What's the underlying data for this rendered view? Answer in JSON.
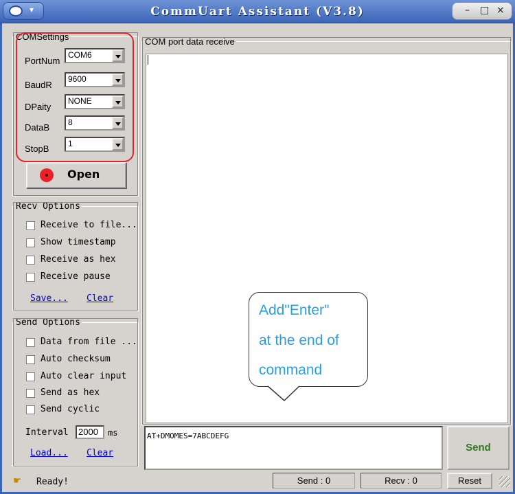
{
  "window": {
    "title": "CommUart Assistant (V3.8)",
    "min": "–",
    "max": "□",
    "close": "×"
  },
  "com_settings": {
    "legend": "COMSettings",
    "fields": [
      {
        "label": "PortNum",
        "value": "COM6"
      },
      {
        "label": "BaudR",
        "value": "9600"
      },
      {
        "label": "DPaity",
        "value": "NONE"
      },
      {
        "label": "DataB",
        "value": "8"
      },
      {
        "label": "StopB",
        "value": "1"
      }
    ],
    "open_label": "Open",
    "led_color": "#e8222a"
  },
  "recv_options": {
    "legend": "Recv Options",
    "checks": [
      "Receive to file...",
      "Show timestamp",
      "Receive as hex",
      "Receive pause"
    ],
    "save": "Save...",
    "clear": "Clear"
  },
  "send_options": {
    "legend": "Send Options",
    "checks": [
      "Data from file ...",
      "Auto checksum",
      "Auto clear input",
      "Send as hex",
      "Send cyclic"
    ],
    "interval_label": "Interval",
    "interval_value": "2000",
    "interval_unit": "ms",
    "load": "Load...",
    "clear": "Clear"
  },
  "receive": {
    "legend": "COM port data receive"
  },
  "callout": {
    "lines": [
      "Add\"Enter\"",
      "at the end of",
      "command"
    ],
    "color": "#2a9fdf"
  },
  "send": {
    "input_value": "AT+DMOMES=7ABCDEFG",
    "button": "Send"
  },
  "status": {
    "text": "Ready!",
    "send": "Send : 0",
    "recv": "Recv : 0",
    "reset": "Reset"
  }
}
